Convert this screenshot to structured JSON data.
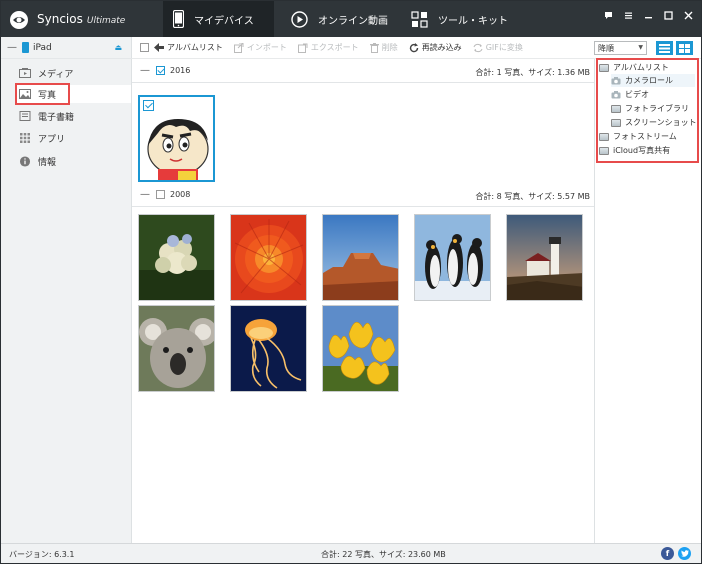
{
  "app": {
    "name": "Syncios",
    "edition": "Ultimate",
    "logo_icon": "syncios-logo-icon"
  },
  "nav_tabs": [
    {
      "label": "マイデバイス",
      "icon": "phone-icon",
      "active": true
    },
    {
      "label": "オンライン動画",
      "icon": "play-circle-icon",
      "active": false
    },
    {
      "label": "ツール・キット",
      "icon": "toolkit-grid-icon",
      "active": false
    }
  ],
  "window_controls": [
    "chat-icon",
    "menu-icon",
    "minimize-icon",
    "close-icon"
  ],
  "sidebar": {
    "device": {
      "name": "iPad",
      "icon": "ipad-icon"
    },
    "items": [
      {
        "label": "メディア",
        "icon": "media-icon"
      },
      {
        "label": "写真",
        "icon": "photo-icon",
        "selected": true
      },
      {
        "label": "電子書籍",
        "icon": "ebook-icon"
      },
      {
        "label": "アプリ",
        "icon": "apps-grid-icon"
      },
      {
        "label": "情報",
        "icon": "info-icon"
      }
    ]
  },
  "toolbar": {
    "album_list": "アルバムリスト",
    "import": "インポート",
    "export": "エクスポート",
    "delete": "削除",
    "reload": "再読み込み",
    "gif": "GIFに変換",
    "sort_value": "降順"
  },
  "groups": [
    {
      "year": "2016",
      "summary": "合計: 1 写真、サイズ: 1.36 MB"
    },
    {
      "year": "2008",
      "summary": "合計: 8 写真、サイズ: 5.57 MB"
    }
  ],
  "photos": [
    {
      "subject": "cartoon-character"
    },
    {
      "subject": "hydrangea"
    },
    {
      "subject": "red-chrysanthemum"
    },
    {
      "subject": "desert-mesa"
    },
    {
      "subject": "penguins"
    },
    {
      "subject": "lighthouse"
    },
    {
      "subject": "koala"
    },
    {
      "subject": "jellyfish"
    },
    {
      "subject": "tulips"
    }
  ],
  "right_panel": {
    "root": "アルバムリスト",
    "albums": [
      "カメラロール",
      "ビデオ",
      "フォトライブラリ",
      "スクリーンショット"
    ],
    "photo_stream": "フォトストリーム",
    "icloud": "iCloud写真共有"
  },
  "status": {
    "version": "バージョン: 6.3.1",
    "total": "合計: 22 写真、サイズ: 23.60 MB",
    "social": [
      "facebook-icon",
      "twitter-icon"
    ]
  },
  "colors": {
    "accent": "#1b97d3",
    "titlebar": "#2f3539",
    "highlight": "#e74b4b"
  }
}
